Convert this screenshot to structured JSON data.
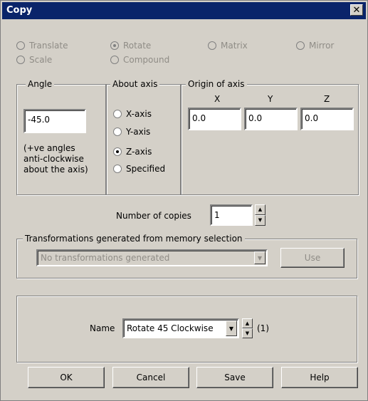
{
  "window": {
    "title": "Copy",
    "close_glyph": "✕"
  },
  "transform_types": [
    {
      "label": "Translate",
      "checked": false
    },
    {
      "label": "Rotate",
      "checked": true
    },
    {
      "label": "Matrix",
      "checked": false
    },
    {
      "label": "Mirror",
      "checked": false
    },
    {
      "label": "Scale",
      "checked": false
    },
    {
      "label": "Compound",
      "checked": false
    }
  ],
  "angle": {
    "group_label": "Angle",
    "value": "-45.0",
    "hint_line1": "(+ve angles",
    "hint_line2": "anti-clockwise",
    "hint_line3": "about the axis)"
  },
  "about_axis": {
    "group_label": "About axis",
    "options": [
      {
        "label": "X-axis",
        "checked": false
      },
      {
        "label": "Y-axis",
        "checked": false
      },
      {
        "label": "Z-axis",
        "checked": true
      },
      {
        "label": "Specified",
        "checked": false
      }
    ]
  },
  "origin": {
    "group_label": "Origin of axis",
    "x_label": "X",
    "y_label": "Y",
    "z_label": "Z",
    "x": "0.0",
    "y": "0.0",
    "z": "0.0"
  },
  "copies": {
    "label": "Number of copies",
    "value": "1"
  },
  "transformations": {
    "group_label": "Transformations generated from memory selection",
    "selected": "No transformations generated",
    "use_label": "Use"
  },
  "name": {
    "label": "Name",
    "selected": "Rotate 45 Clockwise",
    "count": "(1)"
  },
  "buttons": {
    "ok": "OK",
    "cancel": "Cancel",
    "save": "Save",
    "help": "Help"
  }
}
